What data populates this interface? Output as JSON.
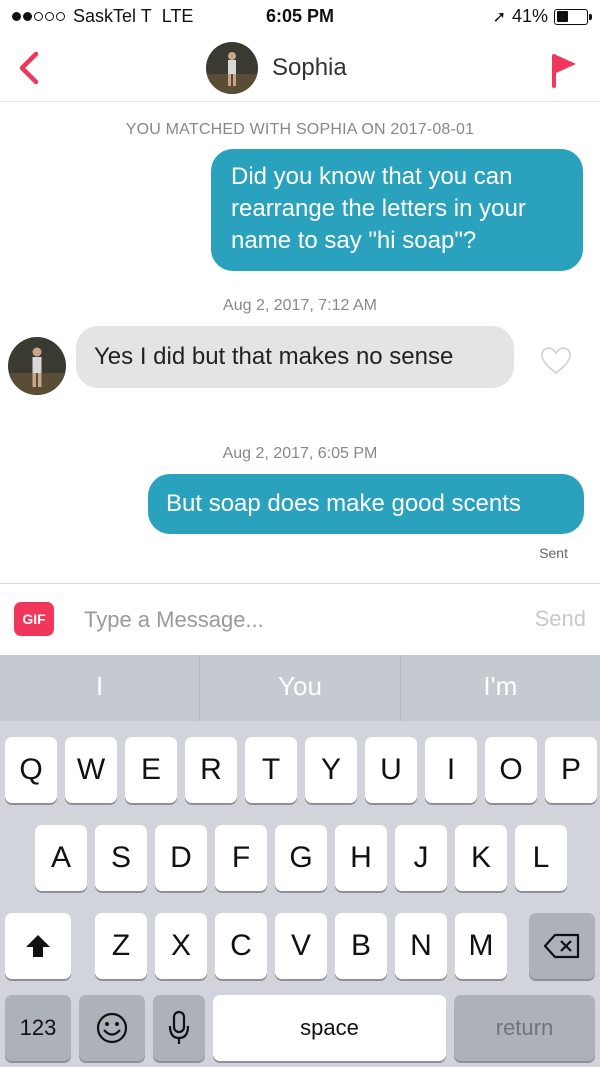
{
  "status_bar": {
    "carrier": "SaskTel T",
    "network": "LTE",
    "time": "6:05 PM",
    "battery": "41%",
    "battery_level": 0.41
  },
  "header": {
    "contact_name": "Sophia"
  },
  "chat": {
    "match_note": "YOU MATCHED WITH SOPHIA ON 2017-08-01",
    "messages": [
      {
        "direction": "outgoing",
        "text": "Did you know that you can rearrange the letters in your name to say \"hi soap\"?"
      },
      {
        "timestamp": "Aug 2, 2017, 7:12 AM"
      },
      {
        "direction": "incoming",
        "text": "Yes I did but that makes no sense"
      },
      {
        "timestamp": "Aug 2, 2017, 6:05 PM"
      },
      {
        "direction": "outgoing",
        "text": "But soap does make good scents",
        "status": "Sent"
      }
    ]
  },
  "compose": {
    "gif_label": "GIF",
    "placeholder": "Type a Message...",
    "send_label": "Send"
  },
  "keyboard": {
    "suggestions": [
      "I",
      "You",
      "I'm"
    ],
    "row1": [
      "Q",
      "W",
      "E",
      "R",
      "T",
      "Y",
      "U",
      "I",
      "O",
      "P"
    ],
    "row2": [
      "A",
      "S",
      "D",
      "F",
      "G",
      "H",
      "J",
      "K",
      "L"
    ],
    "row3": [
      "Z",
      "X",
      "C",
      "V",
      "B",
      "N",
      "M"
    ],
    "numbers_label": "123",
    "space_label": "space",
    "return_label": "return"
  },
  "colors": {
    "accent": "#f0365b",
    "outgoing_bubble": "#2ba2bd",
    "incoming_bubble": "#e4e4e4"
  }
}
